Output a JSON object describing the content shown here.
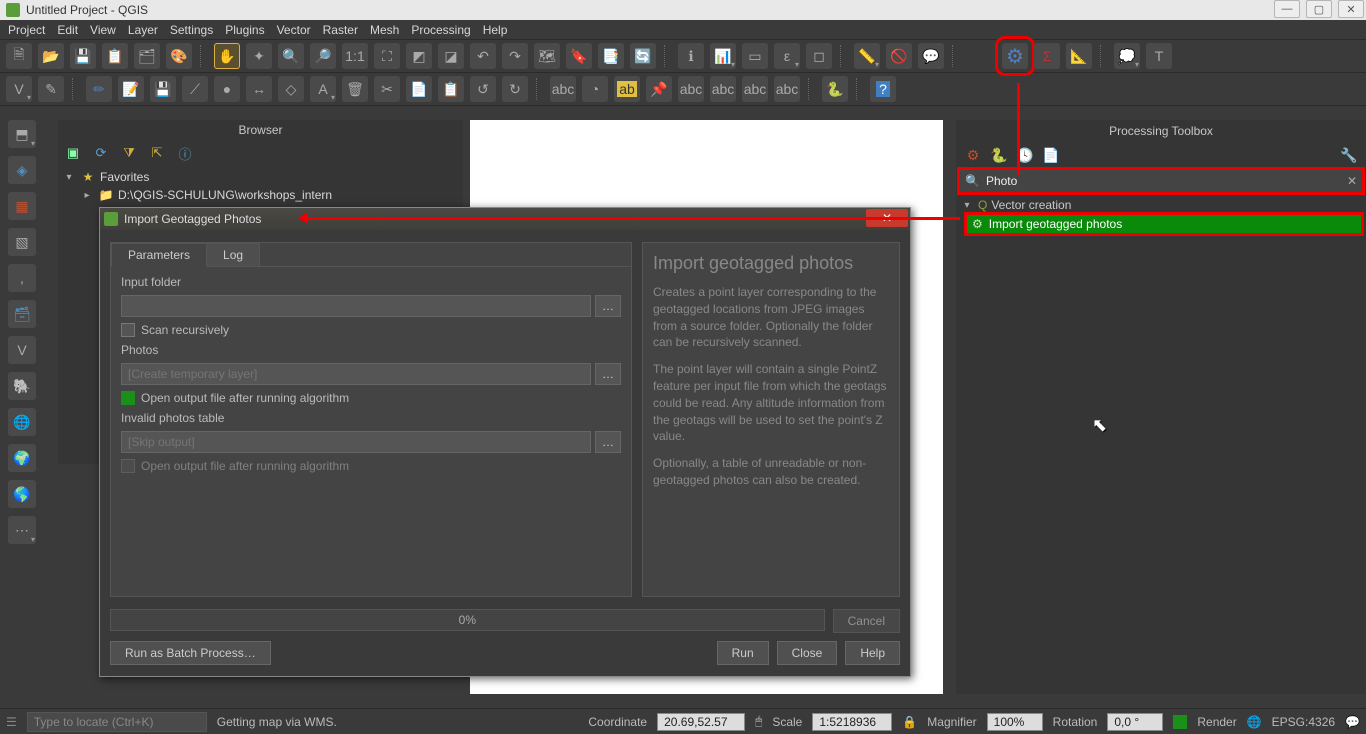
{
  "window": {
    "title": "Untitled Project - QGIS"
  },
  "menu": [
    "Project",
    "Edit",
    "View",
    "Layer",
    "Settings",
    "Plugins",
    "Vector",
    "Raster",
    "Mesh",
    "Processing",
    "Help"
  ],
  "browser": {
    "title": "Browser",
    "favorites": "Favorites",
    "favpath": "D:\\QGIS-SCHULUNG\\workshops_intern"
  },
  "toolbox": {
    "title": "Processing Toolbox",
    "search_value": "Photo",
    "category": "Vector creation",
    "item": "Import geotagged photos"
  },
  "dialog": {
    "title": "Import Geotagged Photos",
    "tabs": {
      "parameters": "Parameters",
      "log": "Log"
    },
    "input_folder_label": "Input folder",
    "scan_label": "Scan recursively",
    "photos_label": "Photos",
    "photos_placeholder": "[Create temporary layer]",
    "open_after1": "Open output file after running algorithm",
    "invalid_label": "Invalid photos table",
    "invalid_placeholder": "[Skip output]",
    "open_after2": "Open output file after running algorithm",
    "help_title": "Import geotagged photos",
    "help_p1": "Creates a point layer corresponding to the geotagged locations from JPEG images from a source folder. Optionally the folder can be recursively scanned.",
    "help_p2": "The point layer will contain a single PointZ feature per input file from which the geotags could be read. Any altitude information from the geotags will be used to set the point's Z value.",
    "help_p3": "Optionally, a table of unreadable or non-geotagged photos can also be created.",
    "progress": "0%",
    "cancel": "Cancel",
    "batch": "Run as Batch Process…",
    "run": "Run",
    "close": "Close",
    "help": "Help"
  },
  "status": {
    "locate_placeholder": "Type to locate (Ctrl+K)",
    "msg": "Getting map via WMS.",
    "coord_label": "Coordinate",
    "coord": "20.69,52.57",
    "scale_label": "Scale",
    "scale": "1:5218936",
    "mag_label": "Magnifier",
    "mag": "100%",
    "rot_label": "Rotation",
    "rot": "0,0 °",
    "render": "Render",
    "crs": "EPSG:4326"
  }
}
